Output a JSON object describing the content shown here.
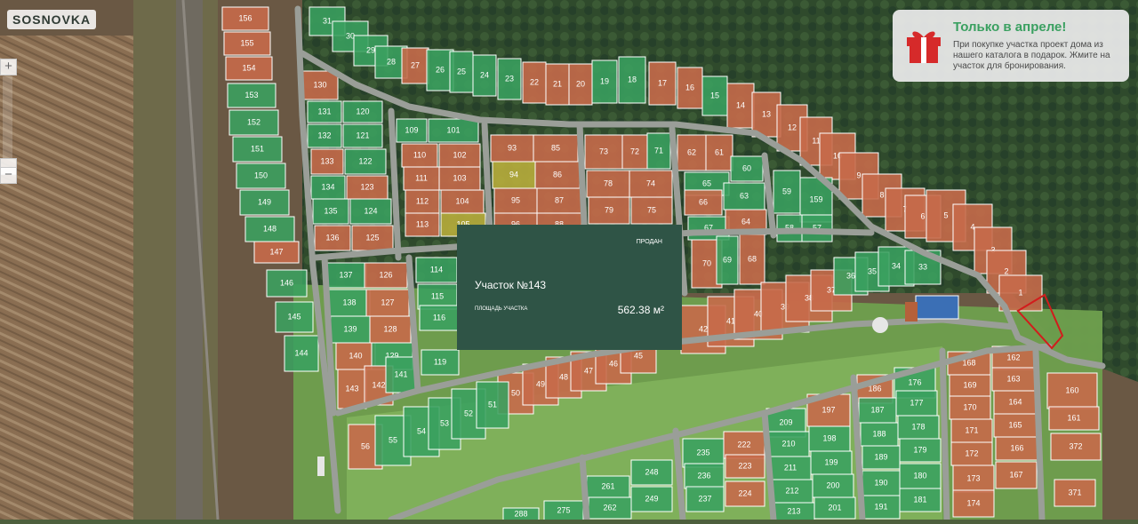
{
  "app": {
    "logo": "SOSNOVKA"
  },
  "zoom": {
    "zoom_in": "+",
    "zoom_out": "−"
  },
  "promo": {
    "title": "Только в апреле!",
    "text": "При покупке участка проект дома из нашего каталога в подарок. Жмите на участок для бронирования.",
    "icon": "gift-icon"
  },
  "info_panel": {
    "status": "продан",
    "title": "Участок №143",
    "area_label": "площадь участка",
    "area_value": "562.38 м²"
  },
  "colors": {
    "available": "#3aa060",
    "sold": "#c66a4a",
    "reserved": "#b8ad3c",
    "panel": "#2f5446"
  },
  "plots": [
    {
      "n": "156",
      "s": "sold"
    },
    {
      "n": "155",
      "s": "sold"
    },
    {
      "n": "154",
      "s": "sold"
    },
    {
      "n": "153",
      "s": "available"
    },
    {
      "n": "152",
      "s": "available"
    },
    {
      "n": "151",
      "s": "available"
    },
    {
      "n": "150",
      "s": "available"
    },
    {
      "n": "149",
      "s": "available"
    },
    {
      "n": "148",
      "s": "available"
    },
    {
      "n": "147",
      "s": "sold"
    },
    {
      "n": "146",
      "s": "available"
    },
    {
      "n": "145",
      "s": "available"
    },
    {
      "n": "144",
      "s": "available"
    },
    {
      "n": "31",
      "s": "available"
    },
    {
      "n": "30",
      "s": "available"
    },
    {
      "n": "29",
      "s": "available"
    },
    {
      "n": "28",
      "s": "available"
    },
    {
      "n": "27",
      "s": "sold"
    },
    {
      "n": "26",
      "s": "available"
    },
    {
      "n": "25",
      "s": "available"
    },
    {
      "n": "24",
      "s": "available"
    },
    {
      "n": "23",
      "s": "available"
    },
    {
      "n": "22",
      "s": "sold"
    },
    {
      "n": "21",
      "s": "sold"
    },
    {
      "n": "20",
      "s": "sold"
    },
    {
      "n": "19",
      "s": "available"
    },
    {
      "n": "18",
      "s": "available"
    },
    {
      "n": "17",
      "s": "sold"
    },
    {
      "n": "16",
      "s": "sold"
    },
    {
      "n": "15",
      "s": "available"
    },
    {
      "n": "14",
      "s": "sold"
    },
    {
      "n": "13",
      "s": "sold"
    },
    {
      "n": "12",
      "s": "sold"
    },
    {
      "n": "11",
      "s": "sold"
    },
    {
      "n": "10",
      "s": "sold"
    },
    {
      "n": "9",
      "s": "sold"
    },
    {
      "n": "8",
      "s": "sold"
    },
    {
      "n": "7",
      "s": "sold"
    },
    {
      "n": "6",
      "s": "sold"
    },
    {
      "n": "5",
      "s": "sold"
    },
    {
      "n": "4",
      "s": "sold"
    },
    {
      "n": "3",
      "s": "sold"
    },
    {
      "n": "2",
      "s": "sold"
    },
    {
      "n": "1",
      "s": "sold"
    },
    {
      "n": "130",
      "s": "sold"
    },
    {
      "n": "131",
      "s": "available"
    },
    {
      "n": "120",
      "s": "available"
    },
    {
      "n": "132",
      "s": "available"
    },
    {
      "n": "121",
      "s": "available"
    },
    {
      "n": "133",
      "s": "sold"
    },
    {
      "n": "122",
      "s": "available"
    },
    {
      "n": "134",
      "s": "available"
    },
    {
      "n": "123",
      "s": "sold"
    },
    {
      "n": "135",
      "s": "available"
    },
    {
      "n": "124",
      "s": "available"
    },
    {
      "n": "136",
      "s": "sold"
    },
    {
      "n": "125",
      "s": "sold"
    },
    {
      "n": "109",
      "s": "available"
    },
    {
      "n": "101",
      "s": "available"
    },
    {
      "n": "110",
      "s": "sold"
    },
    {
      "n": "102",
      "s": "sold"
    },
    {
      "n": "111",
      "s": "sold"
    },
    {
      "n": "103",
      "s": "sold"
    },
    {
      "n": "112",
      "s": "sold"
    },
    {
      "n": "104",
      "s": "sold"
    },
    {
      "n": "113",
      "s": "sold"
    },
    {
      "n": "105",
      "s": "reserved"
    },
    {
      "n": "93",
      "s": "sold"
    },
    {
      "n": "85",
      "s": "sold"
    },
    {
      "n": "94",
      "s": "reserved"
    },
    {
      "n": "86",
      "s": "sold"
    },
    {
      "n": "95",
      "s": "sold"
    },
    {
      "n": "87",
      "s": "sold"
    },
    {
      "n": "96",
      "s": "sold"
    },
    {
      "n": "88",
      "s": "sold"
    },
    {
      "n": "73",
      "s": "sold"
    },
    {
      "n": "72",
      "s": "sold"
    },
    {
      "n": "71",
      "s": "available"
    },
    {
      "n": "78",
      "s": "sold"
    },
    {
      "n": "74",
      "s": "sold"
    },
    {
      "n": "79",
      "s": "sold"
    },
    {
      "n": "75",
      "s": "sold"
    },
    {
      "n": "62",
      "s": "sold"
    },
    {
      "n": "61",
      "s": "sold"
    },
    {
      "n": "60",
      "s": "available"
    },
    {
      "n": "65",
      "s": "available"
    },
    {
      "n": "66",
      "s": "sold"
    },
    {
      "n": "63",
      "s": "available"
    },
    {
      "n": "67",
      "s": "available"
    },
    {
      "n": "64",
      "s": "sold"
    },
    {
      "n": "70",
      "s": "sold"
    },
    {
      "n": "69",
      "s": "available"
    },
    {
      "n": "68",
      "s": "sold"
    },
    {
      "n": "59",
      "s": "available"
    },
    {
      "n": "159",
      "s": "available"
    },
    {
      "n": "58",
      "s": "available"
    },
    {
      "n": "57",
      "s": "available"
    },
    {
      "n": "137",
      "s": "available"
    },
    {
      "n": "126",
      "s": "sold"
    },
    {
      "n": "138",
      "s": "available"
    },
    {
      "n": "127",
      "s": "sold"
    },
    {
      "n": "139",
      "s": "available"
    },
    {
      "n": "128",
      "s": "sold"
    },
    {
      "n": "140",
      "s": "sold"
    },
    {
      "n": "129",
      "s": "available"
    },
    {
      "n": "143",
      "s": "sold"
    },
    {
      "n": "142",
      "s": "sold"
    },
    {
      "n": "141",
      "s": "available"
    },
    {
      "n": "114",
      "s": "available"
    },
    {
      "n": "115",
      "s": "available"
    },
    {
      "n": "116",
      "s": "available"
    },
    {
      "n": "119",
      "s": "available"
    },
    {
      "n": "42",
      "s": "sold"
    },
    {
      "n": "41",
      "s": "sold"
    },
    {
      "n": "40",
      "s": "sold"
    },
    {
      "n": "39",
      "s": "sold"
    },
    {
      "n": "38",
      "s": "sold"
    },
    {
      "n": "37",
      "s": "sold"
    },
    {
      "n": "36",
      "s": "available"
    },
    {
      "n": "35",
      "s": "available"
    },
    {
      "n": "34",
      "s": "available"
    },
    {
      "n": "33",
      "s": "available"
    },
    {
      "n": "50",
      "s": "sold"
    },
    {
      "n": "49",
      "s": "sold"
    },
    {
      "n": "48",
      "s": "sold"
    },
    {
      "n": "47",
      "s": "sold"
    },
    {
      "n": "46",
      "s": "sold"
    },
    {
      "n": "45",
      "s": "sold"
    },
    {
      "n": "56",
      "s": "sold"
    },
    {
      "n": "55",
      "s": "available"
    },
    {
      "n": "54",
      "s": "available"
    },
    {
      "n": "53",
      "s": "available"
    },
    {
      "n": "52",
      "s": "available"
    },
    {
      "n": "51",
      "s": "available"
    },
    {
      "n": "209",
      "s": "available"
    },
    {
      "n": "197",
      "s": "sold"
    },
    {
      "n": "210",
      "s": "available"
    },
    {
      "n": "198",
      "s": "available"
    },
    {
      "n": "211",
      "s": "available"
    },
    {
      "n": "199",
      "s": "available"
    },
    {
      "n": "212",
      "s": "available"
    },
    {
      "n": "200",
      "s": "available"
    },
    {
      "n": "213",
      "s": "available"
    },
    {
      "n": "201",
      "s": "available"
    },
    {
      "n": "186",
      "s": "sold"
    },
    {
      "n": "176",
      "s": "available"
    },
    {
      "n": "187",
      "s": "available"
    },
    {
      "n": "177",
      "s": "available"
    },
    {
      "n": "188",
      "s": "available"
    },
    {
      "n": "178",
      "s": "available"
    },
    {
      "n": "189",
      "s": "available"
    },
    {
      "n": "179",
      "s": "available"
    },
    {
      "n": "190",
      "s": "available"
    },
    {
      "n": "180",
      "s": "available"
    },
    {
      "n": "191",
      "s": "available"
    },
    {
      "n": "181",
      "s": "available"
    },
    {
      "n": "168",
      "s": "sold"
    },
    {
      "n": "162",
      "s": "sold"
    },
    {
      "n": "169",
      "s": "sold"
    },
    {
      "n": "163",
      "s": "sold"
    },
    {
      "n": "170",
      "s": "sold"
    },
    {
      "n": "164",
      "s": "sold"
    },
    {
      "n": "171",
      "s": "sold"
    },
    {
      "n": "165",
      "s": "sold"
    },
    {
      "n": "172",
      "s": "sold"
    },
    {
      "n": "166",
      "s": "sold"
    },
    {
      "n": "173",
      "s": "sold"
    },
    {
      "n": "167",
      "s": "sold"
    },
    {
      "n": "174",
      "s": "sold"
    },
    {
      "n": "160",
      "s": "sold"
    },
    {
      "n": "161",
      "s": "sold"
    },
    {
      "n": "372",
      "s": "sold"
    },
    {
      "n": "371",
      "s": "sold"
    },
    {
      "n": "235",
      "s": "available"
    },
    {
      "n": "222",
      "s": "sold"
    },
    {
      "n": "236",
      "s": "available"
    },
    {
      "n": "223",
      "s": "sold"
    },
    {
      "n": "237",
      "s": "available"
    },
    {
      "n": "224",
      "s": "sold"
    },
    {
      "n": "248",
      "s": "available"
    },
    {
      "n": "261",
      "s": "available"
    },
    {
      "n": "249",
      "s": "available"
    },
    {
      "n": "262",
      "s": "available"
    },
    {
      "n": "275",
      "s": "available"
    },
    {
      "n": "288",
      "s": "available"
    }
  ]
}
